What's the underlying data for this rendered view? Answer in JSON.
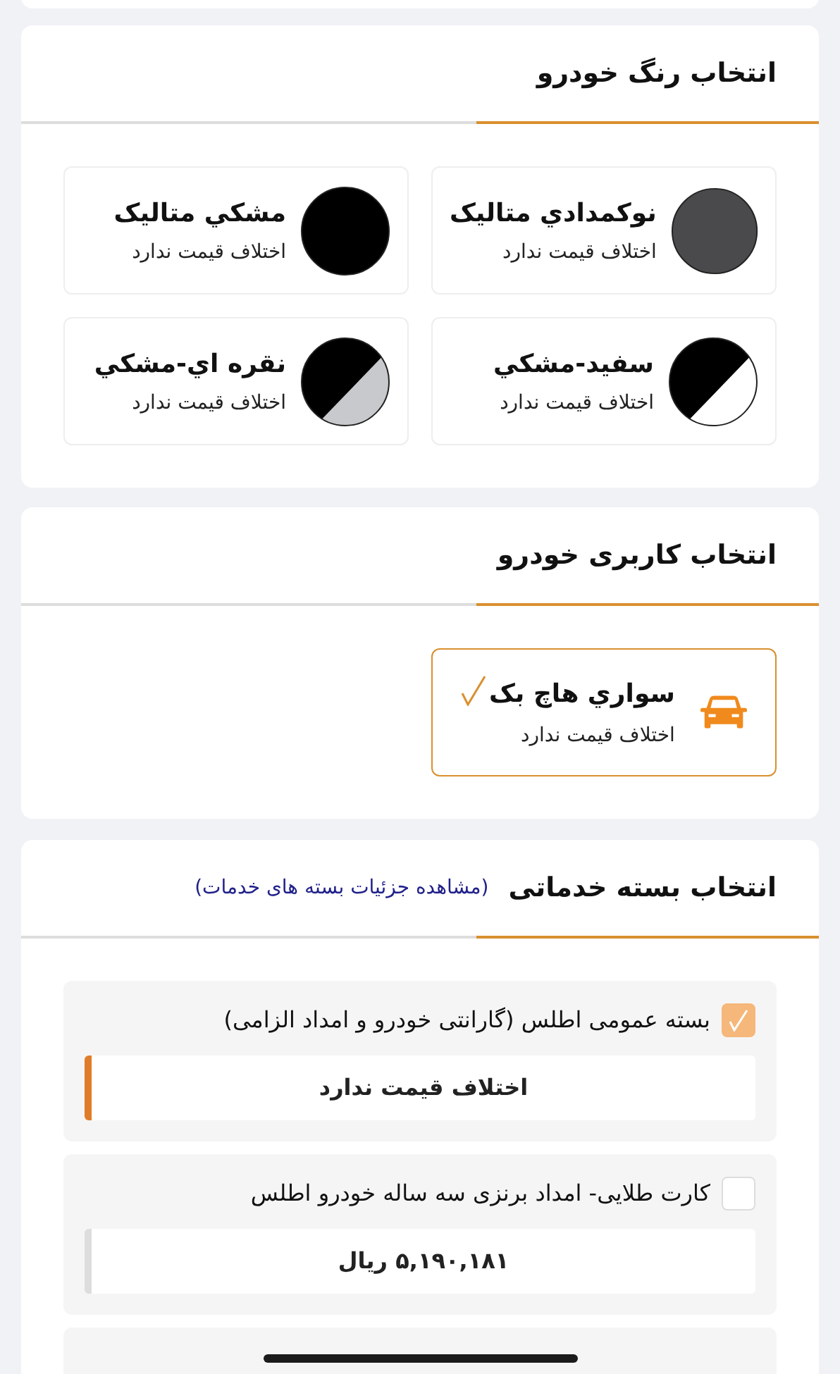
{
  "color_section": {
    "title": "انتخاب رنگ خودرو",
    "options": [
      {
        "name": "نوکمدادي متاليک",
        "price_note": "اختلاف قيمت ندارد",
        "kind": "solid",
        "color": "#4a4a4c"
      },
      {
        "name": "مشکي متاليک",
        "price_note": "اختلاف قيمت ندارد",
        "kind": "solid",
        "color": "#000000"
      },
      {
        "name": "سفيد-مشکي",
        "price_note": "اختلاف قيمت ندارد",
        "kind": "split",
        "segments": [
          {
            "color": "#000000"
          },
          {
            "color": "#ffffff"
          }
        ]
      },
      {
        "name": "نقره اي-مشکي",
        "price_note": "اختلاف قيمت ندارد",
        "kind": "split",
        "segments": [
          {
            "color": "#000000"
          },
          {
            "color": "#c8c9cc"
          }
        ]
      }
    ]
  },
  "usage_section": {
    "title": "انتخاب کاربری خودرو",
    "options": [
      {
        "name": "سواري هاچ بک",
        "price_note": "اختلاف قيمت ندارد",
        "selected": true
      }
    ]
  },
  "services_section": {
    "title": "انتخاب بسته خدماتی",
    "details_link": "(مشاهده جزئیات بسته های خدمات)",
    "packages": [
      {
        "label": "بسته عمومی اطلس (گارانتی خودرو و امداد الزامی)",
        "price": "اختلاف قیمت ندارد",
        "checked": true
      },
      {
        "label": "کارت طلایی- امداد برنزی سه ساله خودرو اطلس",
        "price": "۵,۱۹۰,۱۸۱ ریال",
        "checked": false
      }
    ]
  }
}
